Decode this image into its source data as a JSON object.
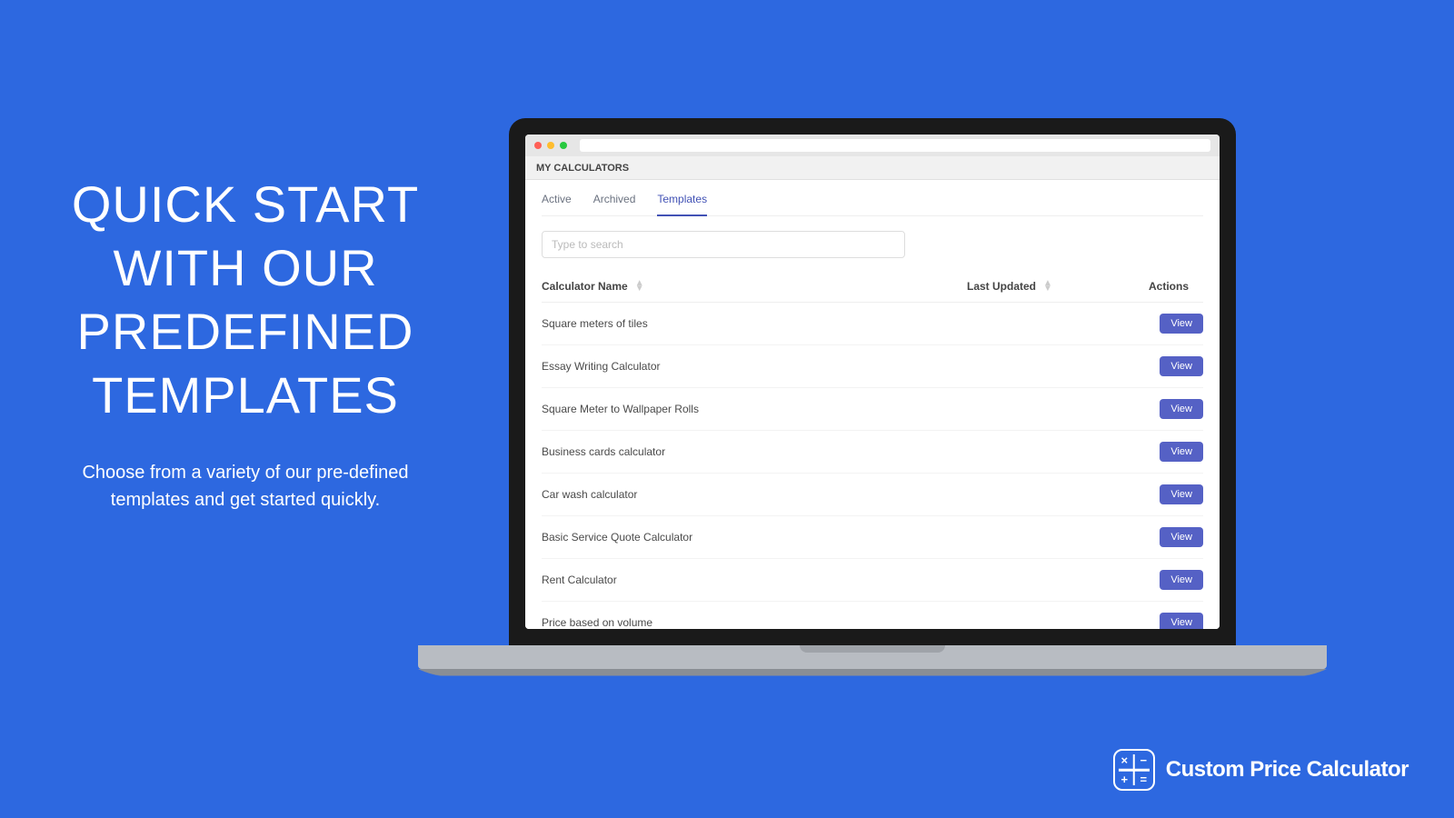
{
  "hero": {
    "title": "QUICK START WITH OUR PREDEFINED TEMPLATES",
    "subtitle": "Choose from a variety of our pre-defined templates and get started quickly."
  },
  "app": {
    "header": "MY CALCULATORS",
    "tabs": [
      {
        "label": "Active",
        "active": false
      },
      {
        "label": "Archived",
        "active": false
      },
      {
        "label": "Templates",
        "active": true
      }
    ],
    "search": {
      "placeholder": "Type to search"
    },
    "table": {
      "columns": {
        "name": "Calculator Name",
        "updated": "Last Updated",
        "actions": "Actions"
      },
      "rows": [
        {
          "name": "Square meters of tiles",
          "updated": "",
          "action": "View"
        },
        {
          "name": "Essay Writing Calculator",
          "updated": "",
          "action": "View"
        },
        {
          "name": "Square Meter to Wallpaper Rolls",
          "updated": "",
          "action": "View"
        },
        {
          "name": "Business cards calculator",
          "updated": "",
          "action": "View"
        },
        {
          "name": "Car wash calculator",
          "updated": "",
          "action": "View"
        },
        {
          "name": "Basic Service Quote Calculator",
          "updated": "",
          "action": "View"
        },
        {
          "name": "Rent Calculator",
          "updated": "",
          "action": "View"
        },
        {
          "name": "Price based on volume",
          "updated": "",
          "action": "View"
        }
      ]
    }
  },
  "brand": {
    "name": "Custom Price Calculator",
    "cells": [
      "×",
      "−",
      "+",
      "="
    ]
  }
}
